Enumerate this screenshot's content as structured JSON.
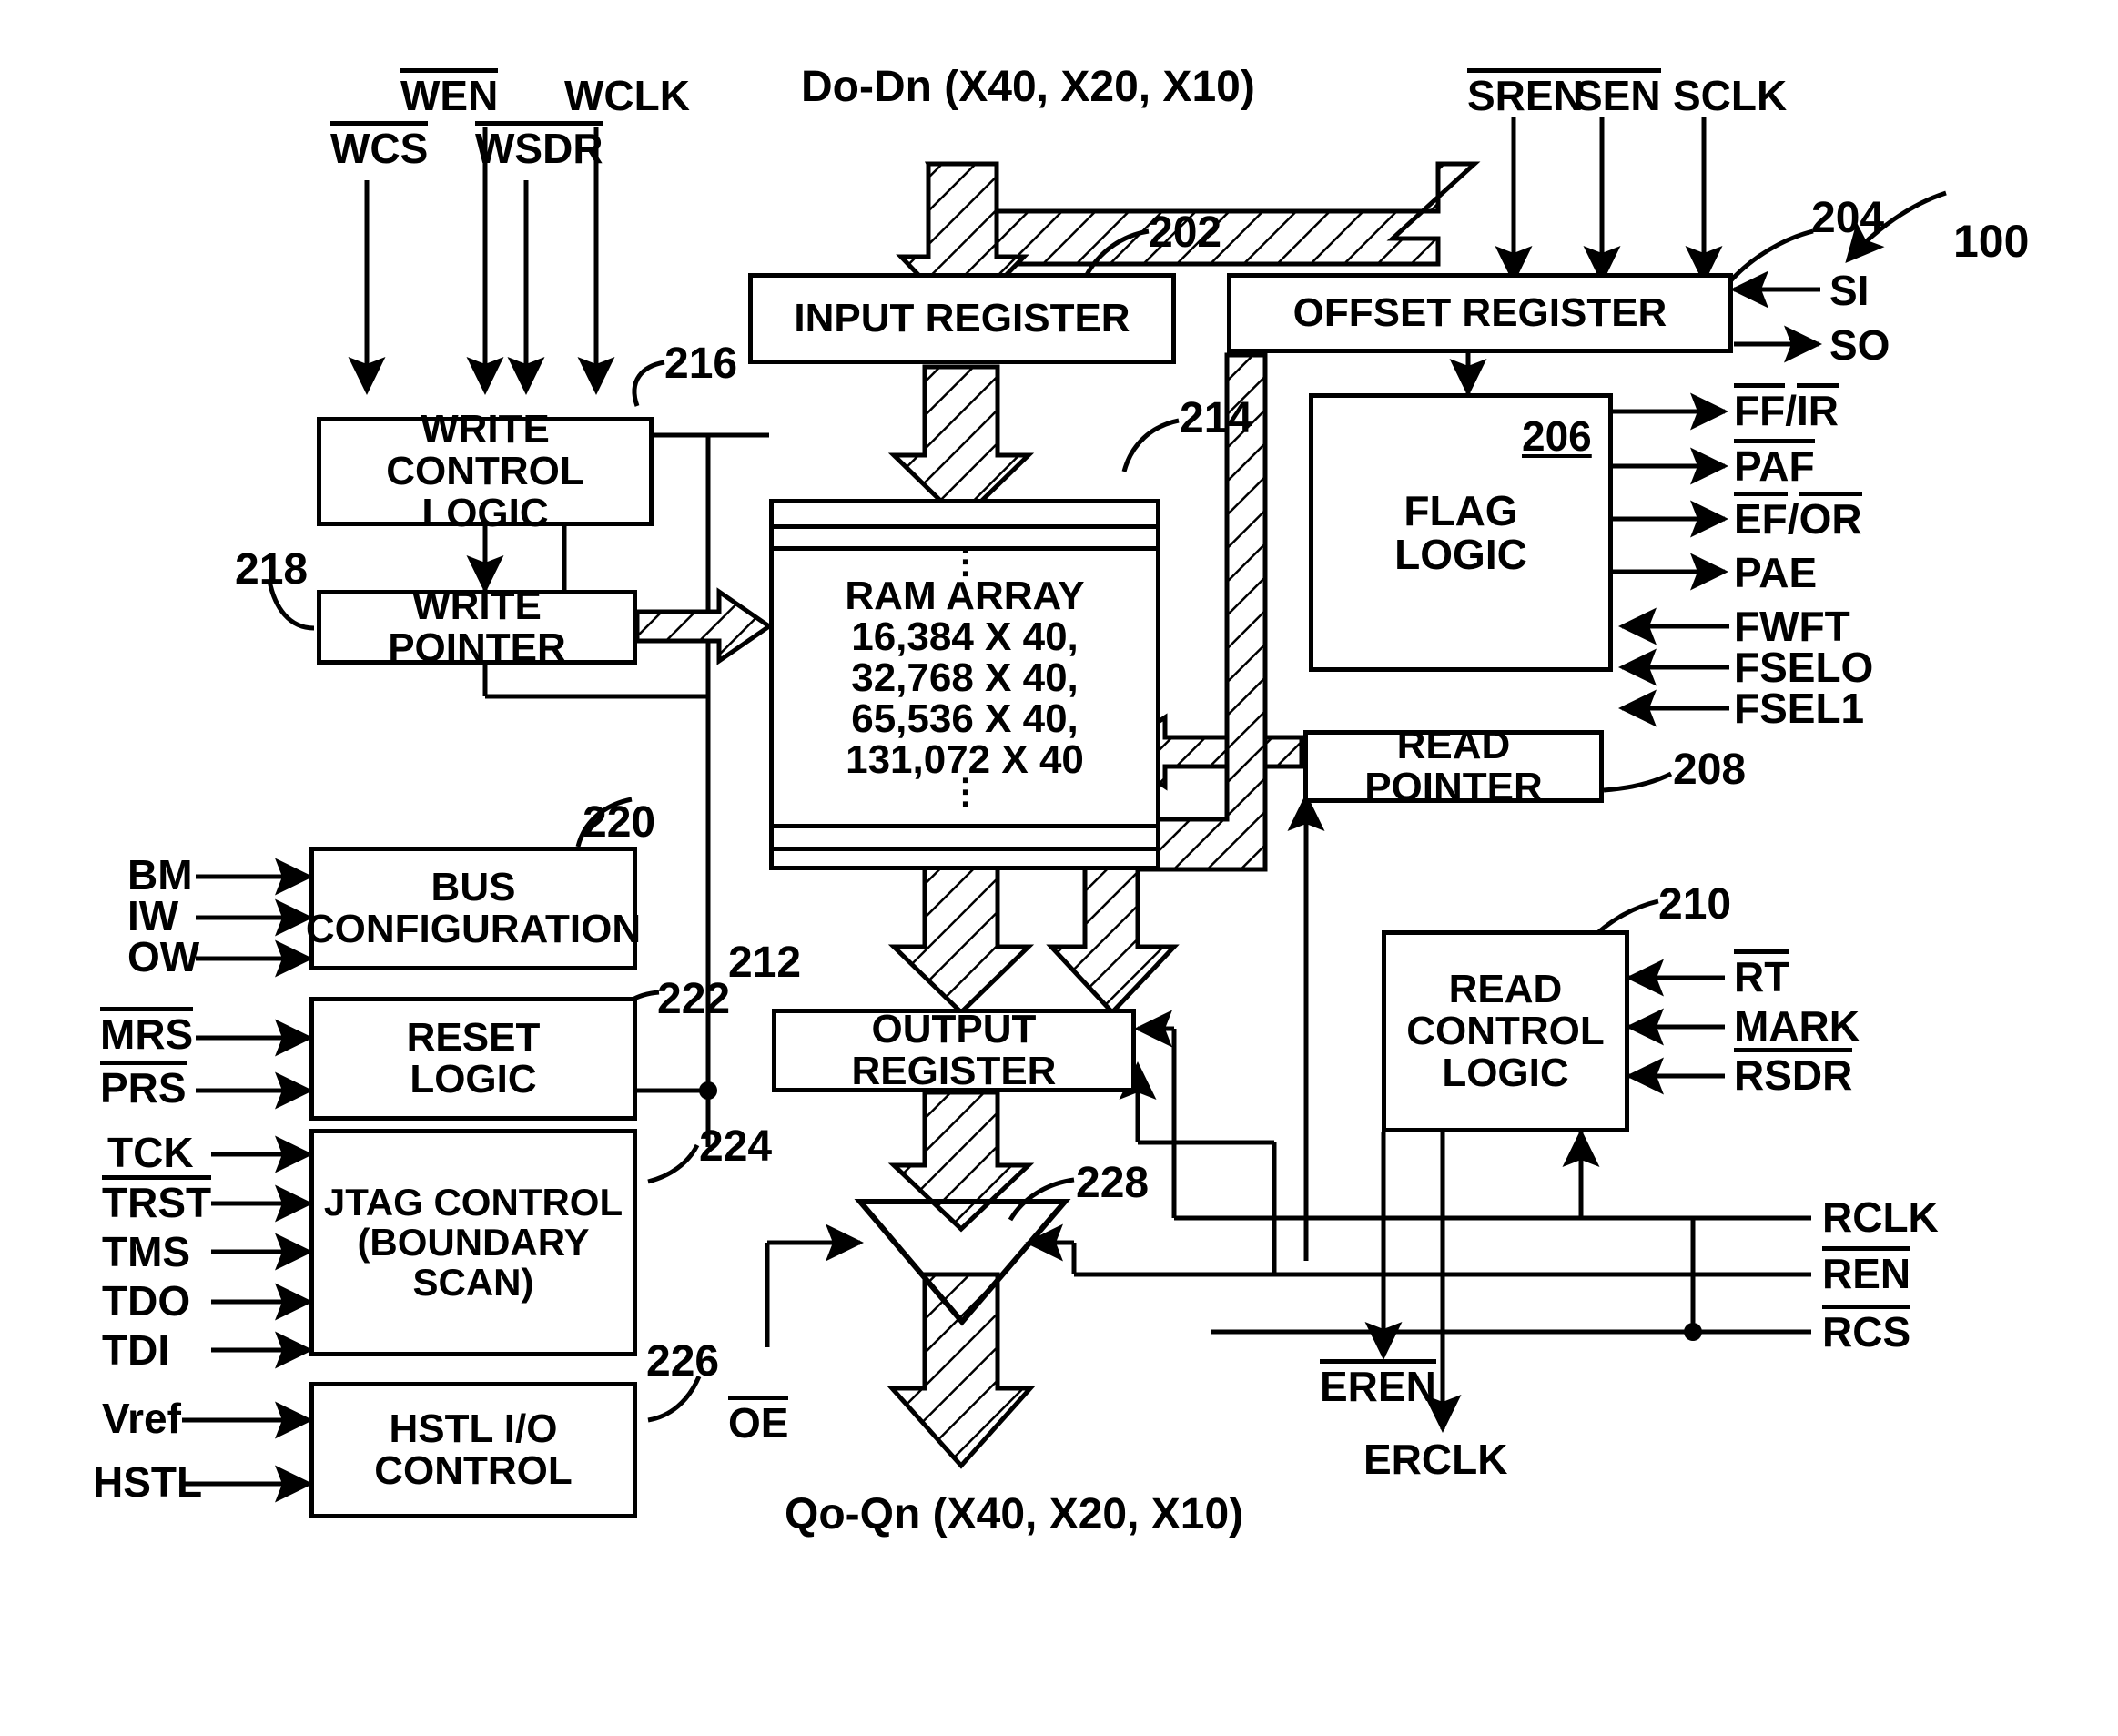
{
  "figure": {
    "reference_main": "100",
    "blocks": [
      {
        "id": "202",
        "label": "INPUT REGISTER"
      },
      {
        "id": "204",
        "label": "OFFSET REGISTER"
      },
      {
        "id": "206",
        "label": "FLAG\nLOGIC"
      },
      {
        "id": "208",
        "label": "READ POINTER"
      },
      {
        "id": "210",
        "label": "READ\nCONTROL\nLOGIC"
      },
      {
        "id": "212",
        "label": "OUTPUT REGISTER"
      },
      {
        "id": "214",
        "label": "RAM ARRAY\n16,384 X 40,\n32,768 X 40,\n65,536 X 40,\n131,072 X 40"
      },
      {
        "id": "216",
        "label": "WRITE CONTROL\nLOGIC"
      },
      {
        "id": "218",
        "label": "WRITE POINTER"
      },
      {
        "id": "220",
        "label": "BUS\nCONFIGURATION"
      },
      {
        "id": "222",
        "label": "RESET\nLOGIC"
      },
      {
        "id": "224",
        "label": "JTAG CONTROL\n(BOUNDARY SCAN)"
      },
      {
        "id": "226",
        "label": "HSTL I/O\nCONTROL"
      },
      {
        "id": "228",
        "label": "output-buffer-triangle"
      }
    ]
  },
  "blocks": {
    "input_register": "INPUT REGISTER",
    "offset_register": "OFFSET REGISTER",
    "flag_logic_l1": "FLAG",
    "flag_logic_l2": "LOGIC",
    "read_pointer": "READ POINTER",
    "read_control_l1": "READ",
    "read_control_l2": "CONTROL",
    "read_control_l3": "LOGIC",
    "output_register": "OUTPUT REGISTER",
    "ram_title": "RAM ARRAY",
    "ram_size1": "16,384 X 40,",
    "ram_size2": "32,768 X 40,",
    "ram_size3": "65,536 X 40,",
    "ram_size4": "131,072 X 40",
    "write_control_l1": "WRITE CONTROL",
    "write_control_l2": "LOGIC",
    "write_pointer": "WRITE POINTER",
    "bus_config_l1": "BUS",
    "bus_config_l2": "CONFIGURATION",
    "reset_logic_l1": "RESET",
    "reset_logic_l2": "LOGIC",
    "jtag_l1": "JTAG CONTROL",
    "jtag_l2": "(BOUNDARY SCAN)",
    "hstl_l1": "HSTL I/O",
    "hstl_l2": "CONTROL"
  },
  "refs": {
    "r100": "100",
    "r202": "202",
    "r204": "204",
    "r206": "206",
    "r208": "208",
    "r210": "210",
    "r212": "212",
    "r214": "214",
    "r216": "216",
    "r218": "218",
    "r220": "220",
    "r222": "222",
    "r224": "224",
    "r226": "226",
    "r228": "228"
  },
  "signals": {
    "wcs": "WCS",
    "wen": "WEN",
    "wsdr": "WSDR",
    "wclk": "WCLK",
    "data_in": "Do-Dn (X40, X20, X10)",
    "sren": "SREN",
    "sen": "SEN",
    "sclk": "SCLK",
    "si": "SI",
    "so": "SO",
    "ff_ir_a": "FF",
    "ff_ir_sep": "/",
    "ff_ir_b": "IR",
    "paf": "PAF",
    "ef_or_a": "EF",
    "ef_or_sep": "/",
    "ef_or_b": "OR",
    "pae": "PAE",
    "fwft": "FWFT",
    "fsel0": "FSELO",
    "fsel1": "FSEL1",
    "rt": "RT",
    "mark": "MARK",
    "rsdr": "RSDR",
    "rclk": "RCLK",
    "ren": "REN",
    "rcs": "RCS",
    "eren": "EREN",
    "erclk": "ERCLK",
    "bm": "BM",
    "iw": "IW",
    "ow": "OW",
    "mrs": "MRS",
    "prs": "PRS",
    "tck": "TCK",
    "trst": "TRST",
    "tms": "TMS",
    "tdo": "TDO",
    "tdi": "TDI",
    "vref": "Vref",
    "hstl": "HSTL",
    "oe": "OE",
    "data_out": "Qo-Qn (X40, X20, X10)"
  }
}
